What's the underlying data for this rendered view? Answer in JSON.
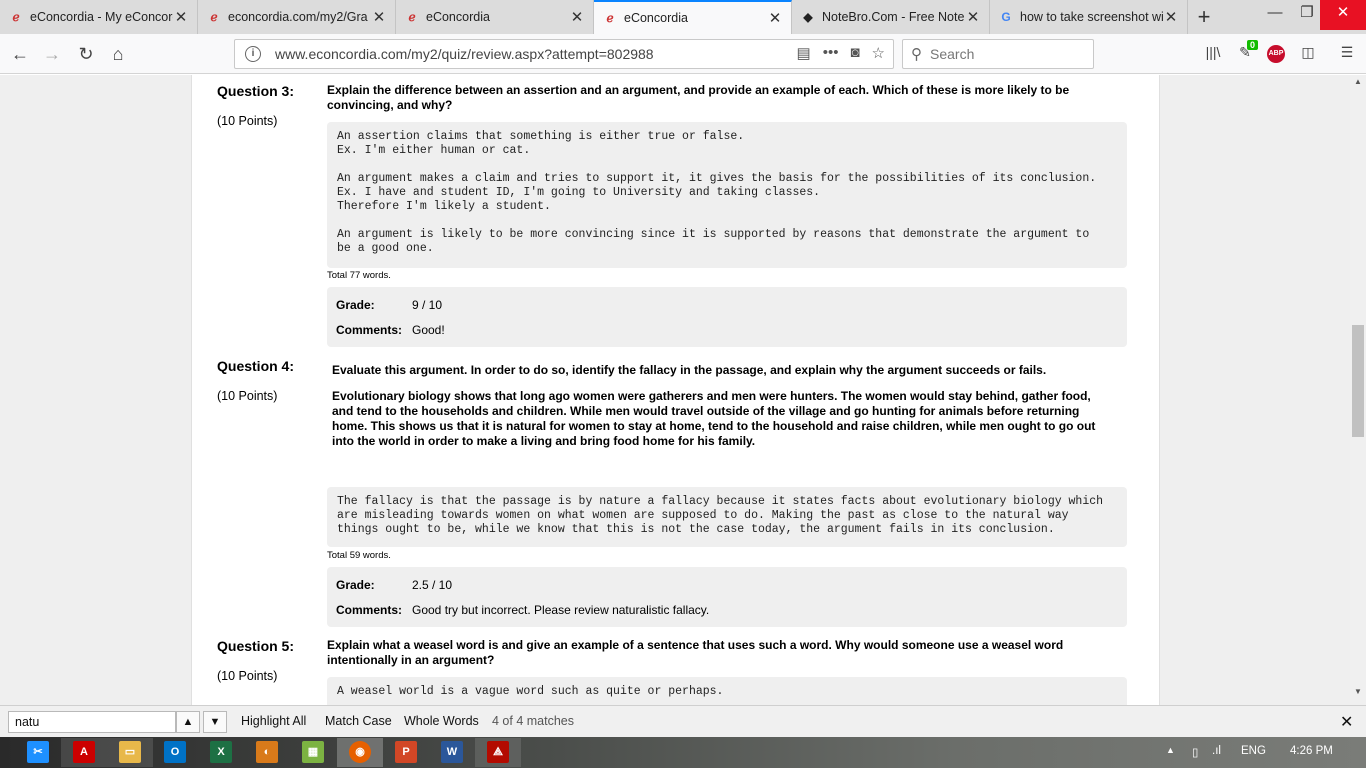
{
  "tabs": [
    {
      "title": "eConcordia - My eConcordia",
      "icon": "econcordia-icon"
    },
    {
      "title": "econcordia.com/my2/Gra",
      "icon": "econcordia-icon"
    },
    {
      "title": "eConcordia",
      "icon": "econcordia-icon"
    },
    {
      "title": "eConcordia",
      "icon": "econcordia-icon",
      "active": true
    },
    {
      "title": "NoteBro.Com - Free Note",
      "icon": "notebro-icon"
    },
    {
      "title": "how to take screenshot wi",
      "icon": "google-icon"
    }
  ],
  "address": {
    "url": "www.econcordia.com/my2/quiz/review.aspx?attempt=802988"
  },
  "search": {
    "placeholder": "Search"
  },
  "toolbar": {
    "addon_badge": "0",
    "abp_label": "ABP"
  },
  "questions": [
    {
      "label": "Question 3:",
      "points": "(10 Points)",
      "prompt": "Explain the difference between an assertion and an argument, and provide an example of each. Which of these is more likely to be convincing, and why?",
      "answer": "An assertion claims that something is either true or false.\nEx. I'm either human or cat.\n\nAn argument makes a claim and tries to support it, it gives the basis for the possibilities of its conclusion.\nEx. I have and student ID, I'm going to University and taking classes.\nTherefore I'm likely a student.\n\nAn argument is likely to be more convincing since it is supported by reasons that demonstrate the argument to\nbe a good one.",
      "total": "Total 77 words.",
      "grade_label": "Grade:",
      "grade": "9 / 10",
      "comments_label": "Comments:",
      "comments": "Good!"
    },
    {
      "label": "Question 4:",
      "points": "(10 Points)",
      "prompt": "Evaluate this argument. In order to do so, identify the fallacy in the passage, and explain why the argument succeeds or fails.",
      "passage": "Evolutionary biology shows that long ago women were gatherers and men were hunters. The women would stay behind, gather food, and tend to the households and children. While men would travel outside of the village and go hunting for animals before returning home. This shows us that it is natural for women to stay at home, tend to the household and raise children, while men ought to go out into the world in order to make a living and bring food home for his family.",
      "answer": "The fallacy is that the passage is by nature a fallacy because it states facts about evolutionary biology which\nare misleading towards women on what women are supposed to do. Making the past as close to the natural way\nthings ought to be, while we know that this is not the case today, the argument fails in its conclusion.",
      "total": "Total 59 words.",
      "grade_label": "Grade:",
      "grade": "2.5 / 10",
      "comments_label": "Comments:",
      "comments": "Good try but incorrect. Please review naturalistic fallacy."
    },
    {
      "label": "Question 5:",
      "points": "(10 Points)",
      "prompt": "Explain what a weasel word is and give an example of a sentence that uses such a word. Why would someone use a weasel word intentionally in an argument?",
      "answer": "A weasel world is a vague word such as quite or perhaps."
    }
  ],
  "findbar": {
    "query": "natu",
    "highlight_all": "Highlight All",
    "match_case": "Match Case",
    "whole_words": "Whole Words",
    "status": "4 of 4 matches"
  },
  "taskbar": {
    "lang": "ENG",
    "time": "4:26 PM"
  }
}
